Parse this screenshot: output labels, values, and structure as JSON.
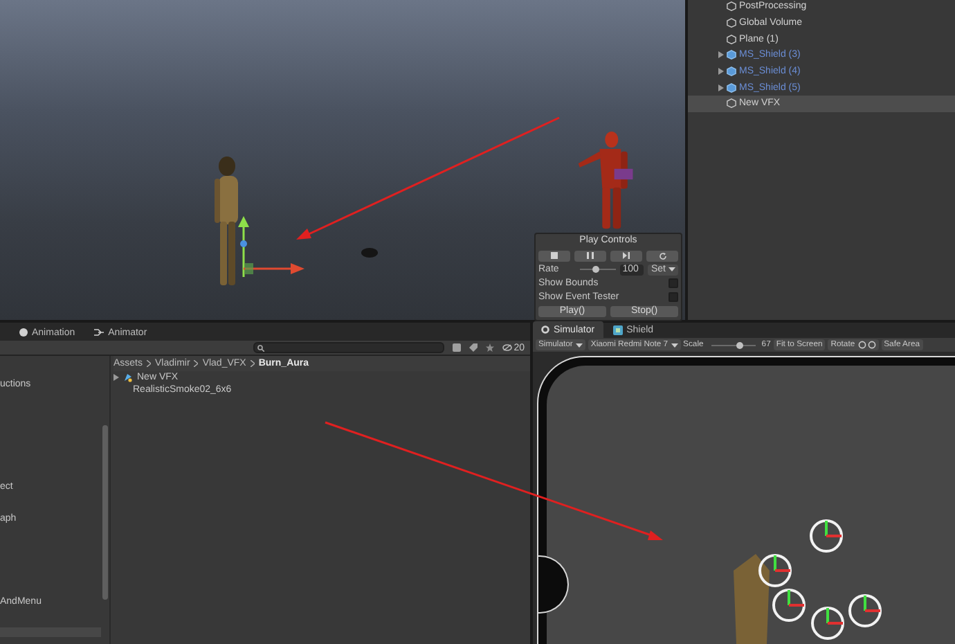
{
  "scene": {
    "play_controls": {
      "title": "Play Controls",
      "transport": [
        {
          "kind": "stop"
        },
        {
          "kind": "pause"
        },
        {
          "kind": "step"
        },
        {
          "kind": "restart"
        }
      ],
      "rate": {
        "label": "Rate",
        "level": 0.47,
        "value": "100",
        "menu": "Set"
      },
      "toggles": [
        {
          "label": "Show Bounds",
          "checked": false
        },
        {
          "label": "Show Event Tester",
          "checked": false
        }
      ],
      "actions": [
        "Play()",
        "Stop()"
      ]
    }
  },
  "hierarchy": {
    "items": [
      {
        "name": "PostProcessing",
        "kind": "object",
        "expandable": false,
        "selected": false
      },
      {
        "name": "Global Volume",
        "kind": "object",
        "expandable": false,
        "selected": false
      },
      {
        "name": "Plane (1)",
        "kind": "object",
        "expandable": false,
        "selected": false
      },
      {
        "name": "MS_Shield (3)",
        "kind": "prefab",
        "expandable": true,
        "selected": false
      },
      {
        "name": "MS_Shield (4)",
        "kind": "prefab",
        "expandable": true,
        "selected": false
      },
      {
        "name": "MS_Shield (5)",
        "kind": "prefab",
        "expandable": true,
        "selected": false
      },
      {
        "name": "New VFX",
        "kind": "object",
        "expandable": false,
        "selected": true
      }
    ]
  },
  "project": {
    "tabs": [
      {
        "label": "Animation",
        "kind": "animation",
        "selected": false
      },
      {
        "label": "Animator",
        "kind": "animator",
        "selected": false
      }
    ],
    "hidden_count": "20",
    "folders": [
      {
        "label": "uctions",
        "selected": false
      },
      {
        "label": "ect",
        "selected": false
      },
      {
        "label": "aph",
        "selected": false
      },
      {
        "label": "AndMenu",
        "selected": false
      }
    ],
    "breadcrumb": [
      "Assets",
      "Vladimir",
      "Vlad_VFX",
      "Burn_Aura"
    ],
    "assets": [
      {
        "name": "New VFX",
        "kind": "vfx",
        "expandable": true
      },
      {
        "name": "RealisticSmoke02_6x6",
        "kind": "texture",
        "expandable": false
      }
    ]
  },
  "simulator": {
    "tabs": [
      {
        "label": "Simulator",
        "kind": "simulator",
        "selected": true
      },
      {
        "label": "Shield",
        "kind": "prefab",
        "selected": false
      }
    ],
    "mode": "Simulator",
    "device": "Xiaomi Redmi Note 7",
    "scale": {
      "label": "Scale",
      "level": 0.64,
      "value": "67"
    },
    "fit_button": "Fit to Screen",
    "rotate_label": "Rotate",
    "safe_area": "Safe Area"
  }
}
